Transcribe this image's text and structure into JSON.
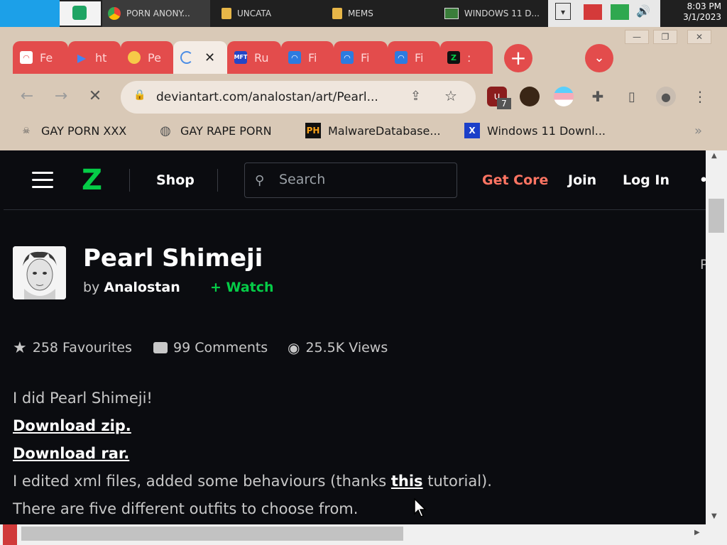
{
  "taskbar": {
    "items": [
      {
        "label": ""
      },
      {
        "label": "PORN ANONY..."
      },
      {
        "label": "UNCATA"
      },
      {
        "label": "MEMS"
      },
      {
        "label": "WINDOWS 11 D..."
      }
    ],
    "time": "8:03 PM",
    "date": "3/1/2023"
  },
  "browser": {
    "tabs": [
      {
        "label": "Fe",
        "icon": "shell-icon"
      },
      {
        "label": "ht",
        "icon": "play-store-icon"
      },
      {
        "label": "Pe",
        "icon": "mario-icon"
      },
      {
        "label": "",
        "icon": "loading-icon",
        "close": "✕"
      },
      {
        "label": "Ru",
        "icon": "mft-icon",
        "icon_text": "MFT"
      },
      {
        "label": "Fi",
        "icon": "file-icon"
      },
      {
        "label": "Fi",
        "icon": "file-icon"
      },
      {
        "label": "Fi",
        "icon": "file-icon"
      },
      {
        "label": ":",
        "icon": "deviantart-icon"
      }
    ],
    "new_tab": "+",
    "url": "deviantart.com/analostan/art/Pearl...",
    "extension_badge": "7",
    "bookmarks": [
      {
        "label": "GAY PORN XXX",
        "icon": "skull-icon"
      },
      {
        "label": "GAY RAPE PORN",
        "icon": "globe-icon"
      },
      {
        "label": "MalwareDatabase...",
        "icon": "ph-icon",
        "icon_text": "PH"
      },
      {
        "label": "Windows 11 Downl...",
        "icon": "x-icon",
        "icon_text": "X"
      }
    ],
    "bookmarks_overflow": "»"
  },
  "site": {
    "header": {
      "shop": "Shop",
      "search_placeholder": "Search",
      "get_core": "Get Core",
      "join": "Join",
      "log_in": "Log In",
      "more": "•"
    },
    "deviation": {
      "title": "Pearl Shimeji",
      "by": "by",
      "author": "Analostan",
      "watch": "Watch",
      "favourites": "258 Favourites",
      "comments": "99 Comments",
      "views": "25.5K Views",
      "right_edge": "P"
    },
    "description": {
      "line1": "I did Pearl Shimeji!",
      "download_zip": "Download zip.",
      "download_rar": "Download rar.",
      "line4_pre": "I edited xml files, added some behaviours (thanks ",
      "line4_link": "this",
      "line4_post": " tutorial).",
      "line5": "There are five different outfits to choose from."
    }
  },
  "colors": {
    "tab_red": "#e34c4c",
    "da_green": "#05cc47",
    "get_core": "#ff7563",
    "page_bg": "#0b0c10"
  }
}
